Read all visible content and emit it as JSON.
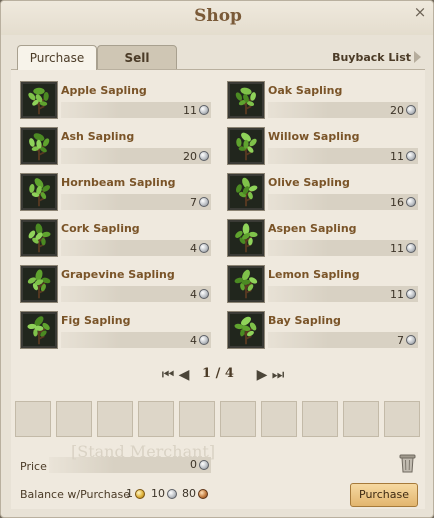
{
  "window": {
    "title": "Shop",
    "close_label": "×"
  },
  "tabs": [
    {
      "label": "Purchase",
      "active": true
    },
    {
      "label": "Sell",
      "active": false
    }
  ],
  "buyback_label": "Buyback List",
  "items": [
    {
      "name": "Apple Sapling",
      "price": "11",
      "icon": "sapling-icon"
    },
    {
      "name": "Oak Sapling",
      "price": "20",
      "icon": "sapling-icon"
    },
    {
      "name": "Ash Sapling",
      "price": "20",
      "icon": "sapling-icon"
    },
    {
      "name": "Willow Sapling",
      "price": "11",
      "icon": "sapling-icon"
    },
    {
      "name": "Hornbeam Sapling",
      "price": "7",
      "icon": "sapling-icon"
    },
    {
      "name": "Olive Sapling",
      "price": "16",
      "icon": "sapling-icon"
    },
    {
      "name": "Cork Sapling",
      "price": "4",
      "icon": "sapling-icon"
    },
    {
      "name": "Aspen Sapling",
      "price": "11",
      "icon": "sapling-icon"
    },
    {
      "name": "Grapevine Sapling",
      "price": "4",
      "icon": "sapling-icon"
    },
    {
      "name": "Lemon Sapling",
      "price": "11",
      "icon": "sapling-icon"
    },
    {
      "name": "Fig Sapling",
      "price": "4",
      "icon": "sapling-icon"
    },
    {
      "name": "Bay Sapling",
      "price": "7",
      "icon": "sapling-icon"
    }
  ],
  "pagination": {
    "text": "1 / 4",
    "current": 1,
    "total": 4
  },
  "cart_slots": 10,
  "watermark_text": "[Stand Merchant]",
  "price": {
    "label": "Price",
    "value": "0"
  },
  "balance": {
    "label": "Balance w/Purchase",
    "gold": "1",
    "silver": "10",
    "copper": "80"
  },
  "purchase_button": "Purchase",
  "colors": {
    "item_name": "#7a5428",
    "title": "#7a5a38",
    "button": "#e2b56e"
  }
}
